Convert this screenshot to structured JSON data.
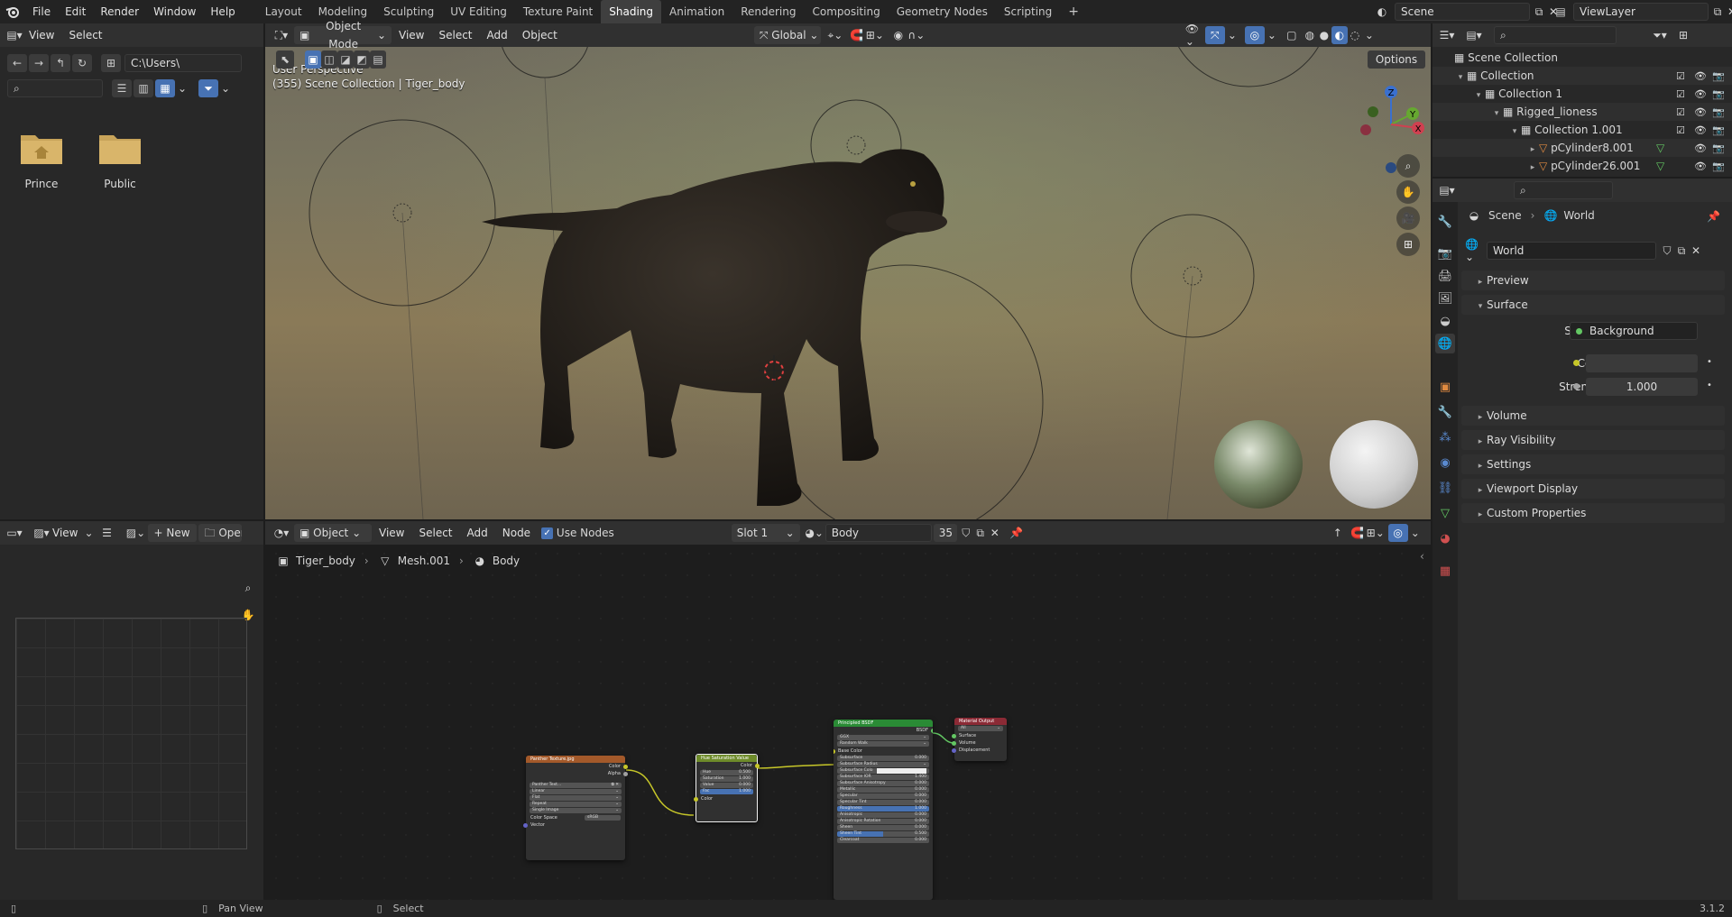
{
  "topbar": {
    "menus": [
      "File",
      "Edit",
      "Render",
      "Window",
      "Help"
    ],
    "workspaces": [
      "Layout",
      "Modeling",
      "Sculpting",
      "UV Editing",
      "Texture Paint",
      "Shading",
      "Animation",
      "Rendering",
      "Compositing",
      "Geometry Nodes",
      "Scripting"
    ],
    "active_workspace": "Shading",
    "add_tab": "+",
    "scene_name": "Scene",
    "view_layer": "ViewLayer"
  },
  "file_browser": {
    "menus": [
      "View",
      "Select"
    ],
    "path": "C:\\Users\\",
    "items": [
      {
        "name": "Prince"
      },
      {
        "name": "Public"
      }
    ]
  },
  "viewport": {
    "mode": "Object Mode",
    "menus": [
      "View",
      "Select",
      "Add",
      "Object"
    ],
    "orientation": "Global",
    "options_label": "Options",
    "overlay_line1": "User Perspective",
    "overlay_line2": "(355) Scene Collection | Tiger_body",
    "gizmo_axes": [
      "Z",
      "Y",
      "X"
    ]
  },
  "image_editor": {
    "view_label": "View",
    "new_label": "New",
    "open_label": "Open"
  },
  "node_editor": {
    "object_label": "Object",
    "menus": [
      "View",
      "Select",
      "Add",
      "Node"
    ],
    "use_nodes_label": "Use Nodes",
    "slot": "Slot 1",
    "material": "Body",
    "user_count": "35",
    "breadcrumb": [
      "Tiger_body",
      "Mesh.001",
      "Body"
    ],
    "nodes": {
      "image_tex": {
        "title": "Panther Texture.jpg",
        "outputs": [
          "Color",
          "Alpha"
        ],
        "image_field": "Panther Text...",
        "dropdowns": [
          "Linear",
          "Flat",
          "Repeat",
          "Single Image"
        ],
        "color_space_label": "Color Space",
        "color_space": "sRGB",
        "input": "Vector"
      },
      "hsv": {
        "title": "Hue Saturation Value",
        "output": "Color",
        "fields": [
          {
            "label": "Hue",
            "value": "0.500"
          },
          {
            "label": "Saturation",
            "value": "1.000"
          },
          {
            "label": "Value",
            "value": "0.000"
          },
          {
            "label": "Fac",
            "value": "1.000"
          }
        ],
        "input": "Color"
      },
      "bsdf": {
        "title": "Principled BSDF",
        "output": "BSDF",
        "dropdowns": [
          "GGX",
          "Random Walk"
        ],
        "base_color": "Base Color",
        "fields": [
          {
            "label": "Subsurface",
            "value": "0.000"
          },
          {
            "label": "Subsurface Radius",
            "value": ""
          },
          {
            "label": "Subsurface Colo",
            "value": ""
          },
          {
            "label": "Subsurface IOR",
            "value": "1.400"
          },
          {
            "label": "Subsurface Anisotropy",
            "value": "0.000"
          },
          {
            "label": "Metallic",
            "value": "0.000"
          },
          {
            "label": "Specular",
            "value": "0.000"
          },
          {
            "label": "Specular Tint",
            "value": "0.000"
          },
          {
            "label": "Roughness",
            "value": "1.000"
          },
          {
            "label": "Anisotropic",
            "value": "0.000"
          },
          {
            "label": "Anisotropic Rotation",
            "value": "0.000"
          },
          {
            "label": "Sheen",
            "value": "0.000"
          },
          {
            "label": "Sheen Tint",
            "value": "0.500"
          },
          {
            "label": "Clearcoat",
            "value": "0.000"
          }
        ]
      },
      "output": {
        "title": "Material Output",
        "target": "All",
        "inputs": [
          "Surface",
          "Volume",
          "Displacement"
        ]
      }
    }
  },
  "outliner": {
    "rows": [
      {
        "label": "Scene Collection",
        "depth": 0
      },
      {
        "label": "Collection",
        "depth": 1
      },
      {
        "label": "Collection 1",
        "depth": 2
      },
      {
        "label": "Rigged_lioness",
        "depth": 3
      },
      {
        "label": "Collection 1.001",
        "depth": 4
      },
      {
        "label": "pCylinder8.001",
        "depth": 5
      },
      {
        "label": "pCylinder26.001",
        "depth": 5
      }
    ]
  },
  "properties": {
    "breadcrumb": [
      "Scene",
      "World"
    ],
    "world_name": "World",
    "panels": {
      "preview": "Preview",
      "surface": "Surface",
      "volume": "Volume",
      "ray_visibility": "Ray Visibility",
      "settings": "Settings",
      "viewport_display": "Viewport Display",
      "custom_properties": "Custom Properties"
    },
    "surface_label": "Surface",
    "surface_value": "Background",
    "color_label": "Color",
    "strength_label": "Strength",
    "strength_value": "1.000"
  },
  "statusbar": {
    "pan_view": "Pan View",
    "select": "Select",
    "version": "3.1.2"
  },
  "colors": {
    "accent": "#4772b3",
    "shader_socket": "#63c763",
    "color_socket": "#c7c729",
    "vector_socket": "#6363c7",
    "image_node_header": "#a3592a",
    "hsv_node_header": "#6e8b2a",
    "bsdf_node_header": "#2a8b35",
    "output_node_header": "#8b2a35"
  }
}
